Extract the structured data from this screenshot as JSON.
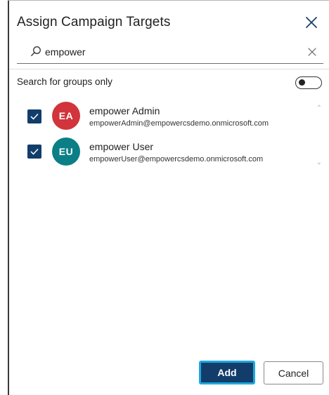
{
  "dialog": {
    "title": "Assign Campaign Targets",
    "close_icon": "close-icon"
  },
  "search": {
    "value": "empower",
    "placeholder": "",
    "search_icon": "search-icon",
    "clear_icon": "clear-icon"
  },
  "groups_toggle": {
    "label": "Search for groups only",
    "state": "off"
  },
  "results": [
    {
      "initials": "EA",
      "name": "empower Admin",
      "email": "empowerAdmin@empowercsdemo.onmicrosoft.com",
      "checked": true,
      "avatar_color": "#d1343a"
    },
    {
      "initials": "EU",
      "name": "empower User",
      "email": "empowerUser@empowercsdemo.onmicrosoft.com",
      "checked": true,
      "avatar_color": "#0b7f85"
    }
  ],
  "footer": {
    "add_label": "Add",
    "cancel_label": "Cancel"
  },
  "colors": {
    "primary": "#123d6b",
    "focus_ring": "#1fa7dd",
    "checkbox": "#123d6b"
  }
}
